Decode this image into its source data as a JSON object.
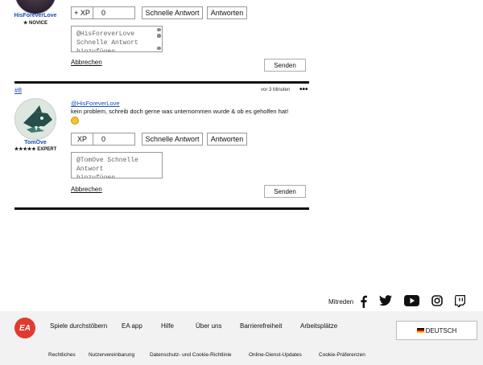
{
  "previous_post": {
    "username": "HisForeverLove",
    "rank": "★ NOVICE",
    "xp_label": "+ XP",
    "xp_value": "0",
    "quick_reply_label": "Schnelle Antwort",
    "reply_label": "Antworten",
    "reply_placeholder": "@HisForeverLove  Schnelle Antwort hinzufügen...",
    "cancel_label": "Abbrechen",
    "send_label": "Senden"
  },
  "post8": {
    "number": "#8",
    "time": "vor 3 Minuten",
    "more_label": "•••",
    "username": "TomOve",
    "rank": "★★★★★ EXPERT",
    "mention": "@HisForeverLove",
    "body": "kein problem, schreib doch gerne was unternommen wurde & ob es geholfen hat!",
    "xp_label": "XP",
    "xp_value": "0",
    "quick_reply_label": "Schnelle Antwort",
    "reply_label": "Antworten",
    "reply_placeholder": "@TomOve  Schnelle Antwort hinzufügen...",
    "cancel_label": "Abbrechen",
    "send_label": "Senden"
  },
  "social": {
    "label": "Mitreden",
    "icons": [
      "facebook-icon",
      "twitter-icon",
      "youtube-icon",
      "instagram-icon",
      "twitch-icon"
    ]
  },
  "footer": {
    "logo_text": "EA",
    "nav": [
      "Spiele durchstöbern",
      "EA app",
      "Hilfe",
      "Über uns",
      "Barrierefreiheit",
      "Arbeitsplätze"
    ],
    "language": "DEUTSCH",
    "legal": [
      "Rechtliches",
      "Nutzervereinbarung",
      "Datenschutz- und Cookie-Richtlinie",
      "Online-Dienst-Updates",
      "Cookie-Präferenzen"
    ]
  },
  "colors": {
    "link": "#1a4fb3",
    "ea_red": "#e23a2e",
    "divider": "#111111"
  }
}
